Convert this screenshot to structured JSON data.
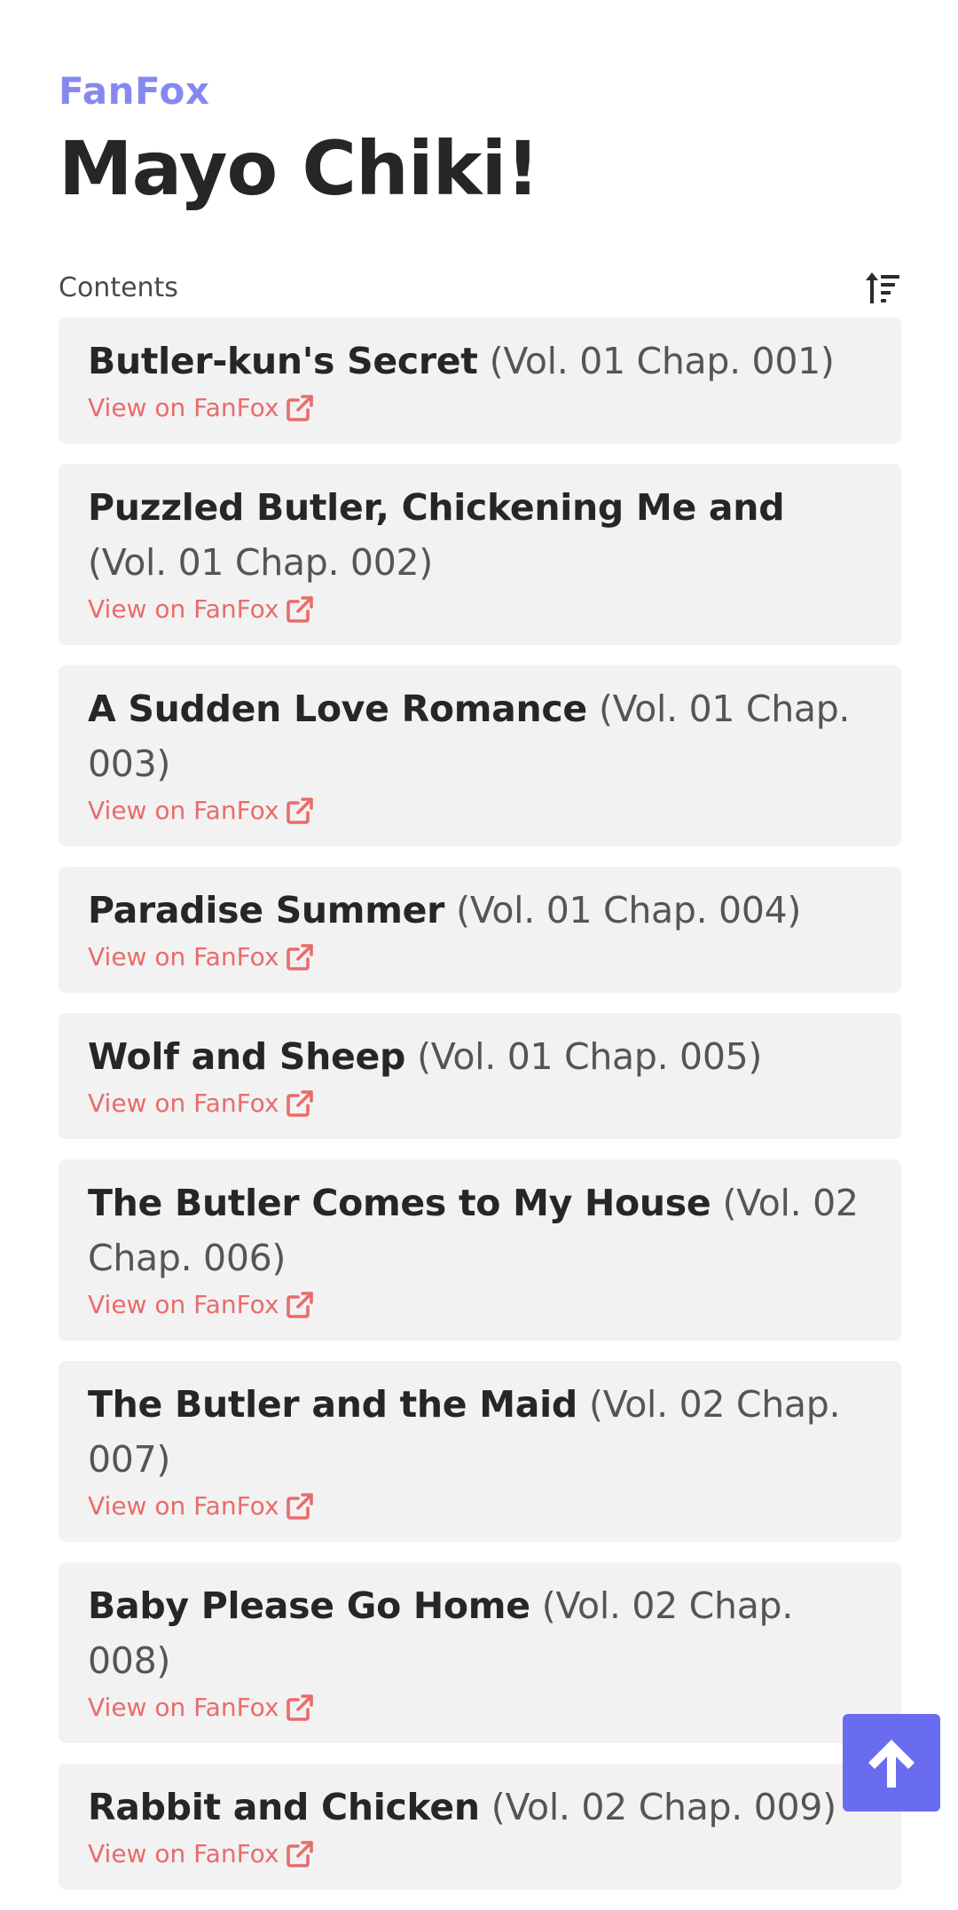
{
  "header": {
    "site_name": "FanFox",
    "series_title": "Mayo Chiki!"
  },
  "contents": {
    "label": "Contents",
    "sort_icon": "sort-ascending-icon"
  },
  "chapters": [
    {
      "title": "Butler-kun's Secret",
      "meta": "(Vol. 01 Chap. 001)",
      "link_label": "View on FanFox"
    },
    {
      "title": "Puzzled Butler, Chickening Me and",
      "meta": "(Vol. 01 Chap. 002)",
      "link_label": "View on FanFox"
    },
    {
      "title": "A Sudden Love Romance",
      "meta": "(Vol. 01 Chap. 003)",
      "link_label": "View on FanFox"
    },
    {
      "title": "Paradise Summer",
      "meta": "(Vol. 01 Chap. 004)",
      "link_label": "View on FanFox"
    },
    {
      "title": "Wolf and Sheep",
      "meta": "(Vol. 01 Chap. 005)",
      "link_label": "View on FanFox"
    },
    {
      "title": "The Butler Comes to My House",
      "meta": "(Vol. 02 Chap. 006)",
      "link_label": "View on FanFox"
    },
    {
      "title": "The Butler and the Maid",
      "meta": "(Vol. 02 Chap. 007)",
      "link_label": "View on FanFox"
    },
    {
      "title": "Baby Please Go Home",
      "meta": "(Vol. 02 Chap. 008)",
      "link_label": "View on FanFox"
    },
    {
      "title": "Rabbit and Chicken",
      "meta": "(Vol. 02 Chap. 009)",
      "link_label": "View on FanFox"
    }
  ],
  "scroll_top": {
    "icon": "arrow-up-icon"
  },
  "colors": {
    "brand": "#8589ef",
    "link": "#ea6b6b",
    "scroll_button": "#6a6cf0",
    "card_background": "#f2f2f2"
  }
}
